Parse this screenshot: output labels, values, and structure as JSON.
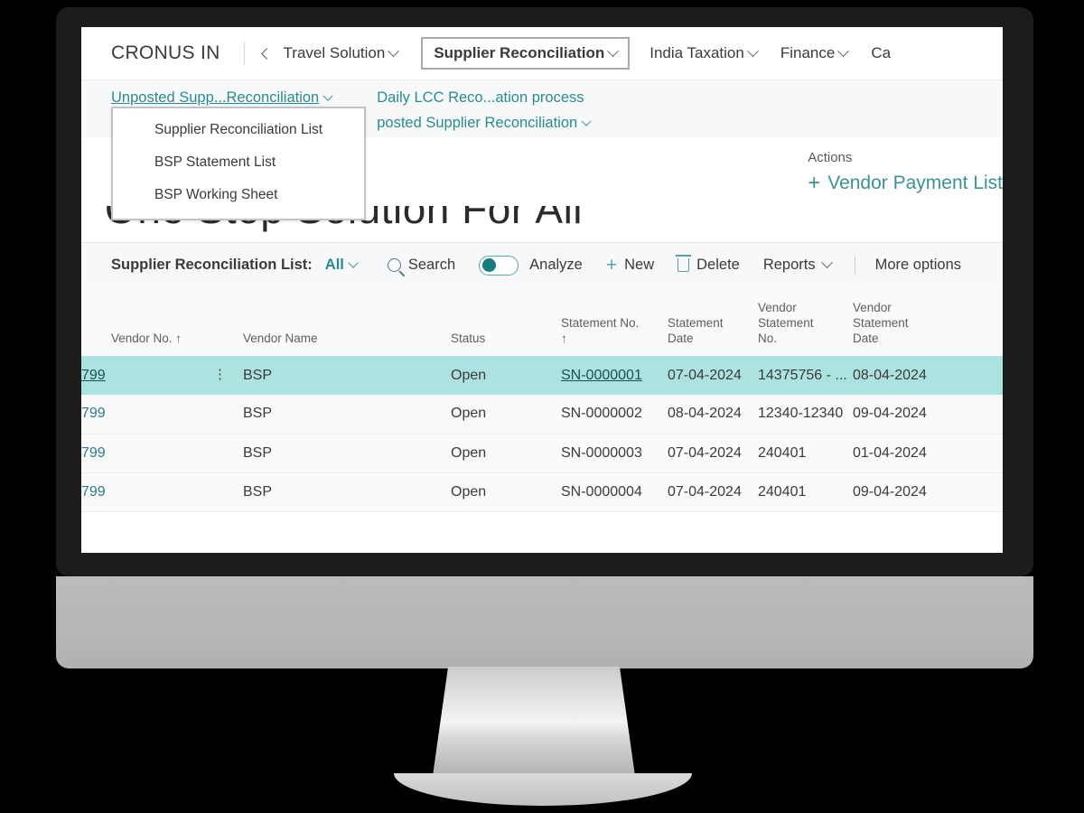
{
  "topnav": {
    "company": "CRONUS IN",
    "back_icon": "chevron-left-icon",
    "items": [
      {
        "label": "Travel Solution",
        "has_caret": true,
        "has_back": true,
        "boxed": false
      },
      {
        "label": "Supplier Reconciliation",
        "has_caret": true,
        "has_back": false,
        "boxed": true
      },
      {
        "label": "India Taxation",
        "has_caret": true,
        "has_back": false,
        "boxed": false
      },
      {
        "label": "Finance",
        "has_caret": true,
        "has_back": false,
        "boxed": false
      },
      {
        "label": "Ca",
        "has_caret": false,
        "has_back": false,
        "boxed": false
      }
    ]
  },
  "subnav": {
    "col1": [
      {
        "label": "Unposted Supp...Reconciliation",
        "caret": true,
        "underlined": true
      }
    ],
    "col2": [
      {
        "label": "Daily LCC Reco...ation process",
        "caret": false,
        "underlined": false
      },
      {
        "label": "posted Supplier Reconciliation",
        "caret": true,
        "underlined": false
      }
    ]
  },
  "dropdown": {
    "items": [
      "Supplier Reconciliation List",
      "BSP Statement List",
      "BSP Working Sheet"
    ]
  },
  "hero": {
    "headline": "One Stop Solution For All",
    "actions_label": "Actions",
    "vendor_payment_label": "Vendor Payment List",
    "plus_icon": "plus-icon"
  },
  "toolbar": {
    "title": "Supplier Reconciliation List:",
    "filter_value": "All",
    "search_label": "Search",
    "search_icon": "search-icon",
    "analyze_label": "Analyze",
    "analyze_toggle_on": true,
    "new_label": "New",
    "new_icon": "plus-icon",
    "delete_label": "Delete",
    "delete_icon": "trash-icon",
    "reports_label": "Reports",
    "more_options_label": "More options"
  },
  "table": {
    "columns": [
      {
        "key": "vendor_no",
        "lines": [
          "Vendor No. ↑"
        ]
      },
      {
        "key": "vendor_name",
        "lines": [
          "Vendor Name"
        ]
      },
      {
        "key": "status",
        "lines": [
          "Status"
        ]
      },
      {
        "key": "statement_no",
        "lines": [
          "Statement No.",
          "↑"
        ]
      },
      {
        "key": "statement_date",
        "lines": [
          "Statement",
          "Date"
        ]
      },
      {
        "key": "vendor_stmt_no",
        "lines": [
          "Vendor",
          "Statement",
          "No."
        ]
      },
      {
        "key": "vendor_stmt_date",
        "lines": [
          "Vendor",
          "Statement",
          "Date"
        ]
      }
    ],
    "rows": [
      {
        "selected": true,
        "vendor_no": "799",
        "vendor_name": "BSP",
        "status": "Open",
        "statement_no": "SN-0000001",
        "statement_date": "07-04-2024",
        "vendor_stmt_no": "14375756 - ...",
        "vendor_stmt_date": "08-04-2024"
      },
      {
        "selected": false,
        "vendor_no": "799",
        "vendor_name": "BSP",
        "status": "Open",
        "statement_no": "SN-0000002",
        "statement_date": "08-04-2024",
        "vendor_stmt_no": "12340-12340",
        "vendor_stmt_date": "09-04-2024"
      },
      {
        "selected": false,
        "vendor_no": "799",
        "vendor_name": "BSP",
        "status": "Open",
        "statement_no": "SN-0000003",
        "statement_date": "07-04-2024",
        "vendor_stmt_no": "240401",
        "vendor_stmt_date": "01-04-2024"
      },
      {
        "selected": false,
        "vendor_no": "799",
        "vendor_name": "BSP",
        "status": "Open",
        "statement_no": "SN-0000004",
        "statement_date": "07-04-2024",
        "vendor_stmt_no": "240401",
        "vendor_stmt_date": "09-04-2024"
      }
    ],
    "row_menu_icon": "ellipsis-vertical-icon"
  },
  "colors": {
    "teal_link": "#2a8c8c",
    "teal_accent": "#3a9296",
    "row_highlight": "#ace3e0",
    "toggle_on": "#157b7b",
    "bezel": "#1c1c1c",
    "chin": "#b9bbbd"
  }
}
